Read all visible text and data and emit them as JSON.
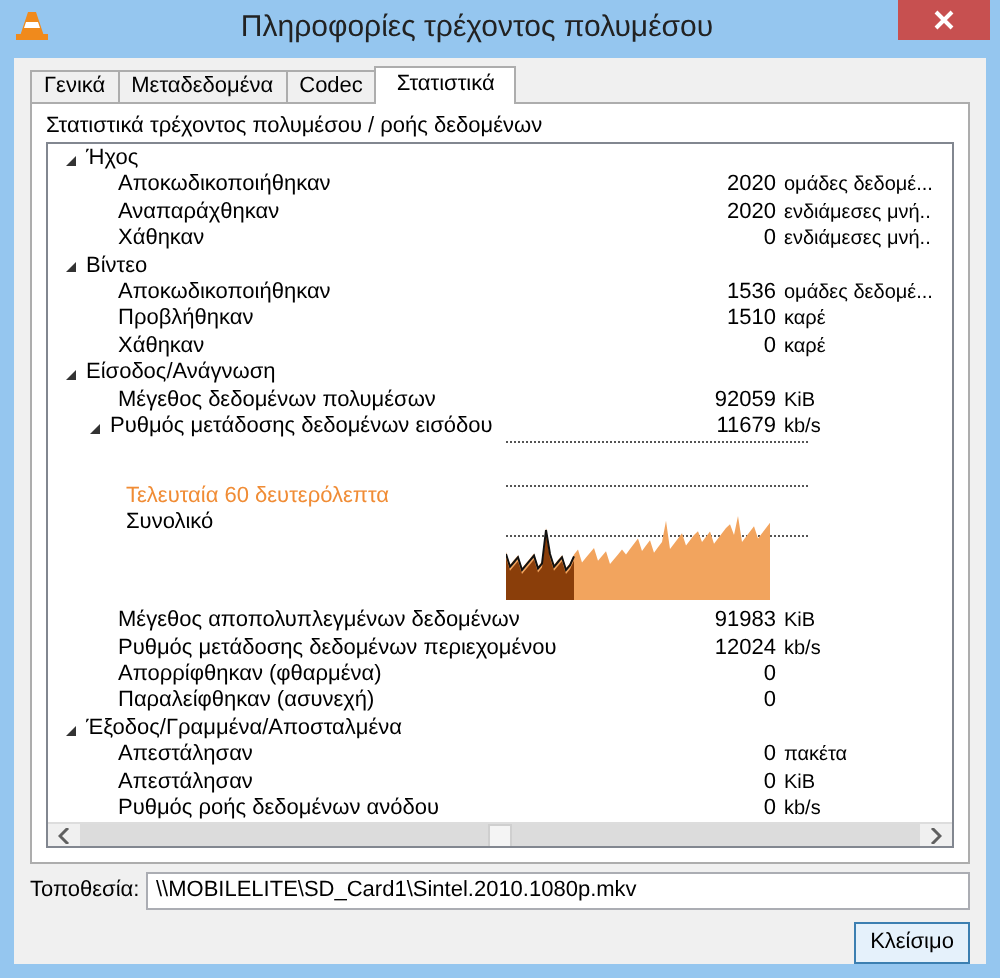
{
  "window": {
    "title": "Πληροφορίες τρέχοντος πολυμέσου"
  },
  "tabs": [
    {
      "label": "Γενικά",
      "selected": false
    },
    {
      "label": "Μεταδεδομένα",
      "selected": false
    },
    {
      "label": "Codec",
      "selected": false
    },
    {
      "label": "Στατιστικά",
      "selected": true
    }
  ],
  "panel_heading": "Στατιστικά τρέχοντος πολυμέσου / ροής δεδομένων",
  "tree": [
    {
      "kind": "group",
      "name": "Ήχος",
      "expanded": true,
      "children": [
        {
          "kind": "stat",
          "name": "Αποκωδικοποιήθηκαν",
          "value": "2020",
          "unit": "ομάδες δεδομέ..."
        },
        {
          "kind": "stat",
          "name": "Αναπαράχθηκαν",
          "value": "2020",
          "unit": "ενδιάμεσες μνή.."
        },
        {
          "kind": "stat",
          "name": "Χάθηκαν",
          "value": "0",
          "unit": "ενδιάμεσες μνή.."
        }
      ]
    },
    {
      "kind": "group",
      "name": "Βίντεο",
      "expanded": true,
      "children": [
        {
          "kind": "stat",
          "name": "Αποκωδικοποιήθηκαν",
          "value": "1536",
          "unit": "ομάδες δεδομέ..."
        },
        {
          "kind": "stat",
          "name": "Προβλήθηκαν",
          "value": "1510",
          "unit": "καρέ"
        },
        {
          "kind": "stat",
          "name": "Χάθηκαν",
          "value": "0",
          "unit": "καρέ"
        }
      ]
    },
    {
      "kind": "group",
      "name": "Είσοδος/Ανάγνωση",
      "expanded": true,
      "children": [
        {
          "kind": "stat",
          "name": "Μέγεθος δεδομένων πολυμέσων",
          "value": "92059",
          "unit": "KiB"
        },
        {
          "kind": "group",
          "name": "Ρυθμός μετάδοσης δεδομένων εισόδου",
          "value": "11679",
          "unit": "kb/s",
          "expanded": true,
          "children": [
            {
              "kind": "graph",
              "legend_recent": "Τελευταία 60 δευτερόλεπτα",
              "legend_total": "Συνολικό"
            }
          ]
        },
        {
          "kind": "stat",
          "name": "Μέγεθος αποπολυπλεγμένων δεδομένων",
          "value": "91983",
          "unit": "KiB"
        },
        {
          "kind": "stat",
          "name": "Ρυθμός μετάδοσης δεδομένων περιεχομένου",
          "value": "12024",
          "unit": "kb/s"
        },
        {
          "kind": "stat",
          "name": "Απορρίφθηκαν (φθαρμένα)",
          "value": "0"
        },
        {
          "kind": "stat",
          "name": "Παραλείφθηκαν (ασυνεχή)",
          "value": "0"
        }
      ]
    },
    {
      "kind": "group",
      "name": "Έξοδος/Γραμμένα/Αποσταλμένα",
      "expanded": true,
      "children": [
        {
          "kind": "stat",
          "name": "Απεστάλησαν",
          "value": "0",
          "unit": "πακέτα"
        },
        {
          "kind": "stat",
          "name": "Απεστάλησαν",
          "value": "0",
          "unit": "KiB"
        },
        {
          "kind": "stat",
          "name": "Ρυθμός ροής δεδομένων ανόδου",
          "value": "0",
          "unit": "kb/s"
        }
      ]
    }
  ],
  "location": {
    "label": "Τοποθεσία:",
    "value": "\\\\MOBILELITE\\SD_Card1\\Sintel.2010.1080p.mkv"
  },
  "buttons": [
    "Κλείσιμο"
  ]
}
